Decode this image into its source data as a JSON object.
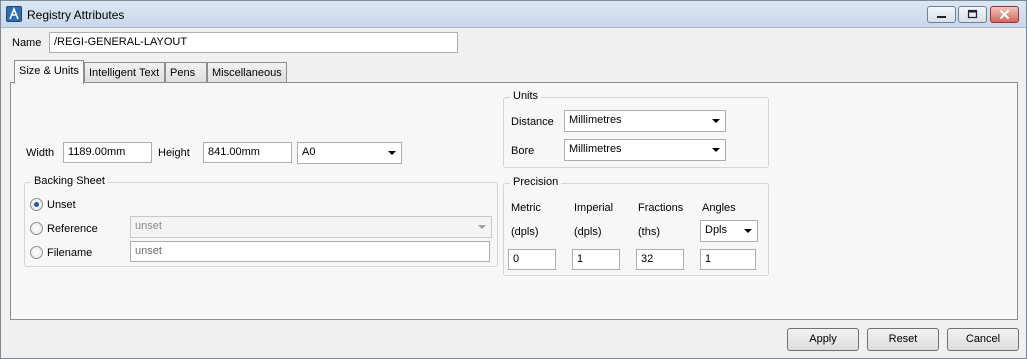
{
  "window": {
    "title": "Registry Attributes"
  },
  "name": {
    "label": "Name",
    "value": "/REGI-GENERAL-LAYOUT"
  },
  "tabs": [
    {
      "label": "Size & Units",
      "active": true
    },
    {
      "label": "Intelligent Text",
      "active": false
    },
    {
      "label": "Pens",
      "active": false
    },
    {
      "label": "Miscellaneous",
      "active": false
    }
  ],
  "size": {
    "width_label": "Width",
    "width_value": "1189.00mm",
    "height_label": "Height",
    "height_value": "841.00mm",
    "sheet_size": "A0"
  },
  "backing_sheet": {
    "title": "Backing Sheet",
    "options": [
      {
        "label": "Unset",
        "checked": true
      },
      {
        "label": "Reference",
        "checked": false
      },
      {
        "label": "Filename",
        "checked": false
      }
    ],
    "reference_value": "unset",
    "filename_placeholder": "unset"
  },
  "units": {
    "title": "Units",
    "distance_label": "Distance",
    "distance_value": "Millimetres",
    "bore_label": "Bore",
    "bore_value": "Millimetres"
  },
  "precision": {
    "title": "Precision",
    "columns": [
      {
        "header": "Metric",
        "sub": "(dpls)",
        "value": "0"
      },
      {
        "header": "Imperial",
        "sub": "(dpls)",
        "value": "1"
      },
      {
        "header": "Fractions",
        "sub": "(ths)",
        "value": "32"
      },
      {
        "header": "Angles",
        "sub": "Dpls",
        "value": "1"
      }
    ]
  },
  "buttons": {
    "apply": "Apply",
    "reset": "Reset",
    "cancel": "Cancel"
  },
  "icons": {
    "app": "app-logo-icon",
    "minimize": "minimize-icon",
    "maximize": "maximize-icon",
    "close": "close-icon",
    "dropdown": "chevron-down-icon"
  }
}
